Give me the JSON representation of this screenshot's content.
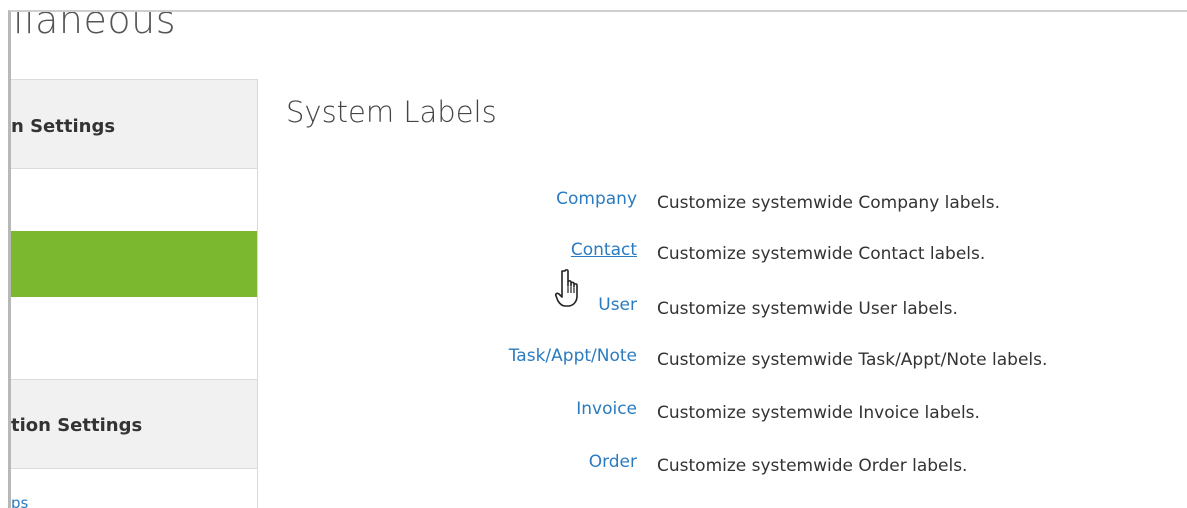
{
  "page_header": {
    "title": "llaneous"
  },
  "sidebar": {
    "section1_title": "n Settings",
    "section2_title": "tion Settings",
    "bottom_link": "ps"
  },
  "main": {
    "title": "System Labels",
    "rows": [
      {
        "link": "Company",
        "description": "Customize systemwide Company labels."
      },
      {
        "link": "Contact",
        "description": "Customize systemwide Contact labels."
      },
      {
        "link": "User",
        "description": "Customize systemwide User labels."
      },
      {
        "link": "Task/Appt/Note",
        "description": "Customize systemwide Task/Appt/Note labels."
      },
      {
        "link": "Invoice",
        "description": "Customize systemwide Invoice labels."
      },
      {
        "link": "Order",
        "description": "Customize systemwide Order labels."
      }
    ]
  },
  "colors": {
    "link": "#2a7bbf",
    "active_item": "#7cb82f",
    "header_bg": "#f1f1f1"
  },
  "icons": {
    "cursor": "hand-pointer-icon"
  }
}
